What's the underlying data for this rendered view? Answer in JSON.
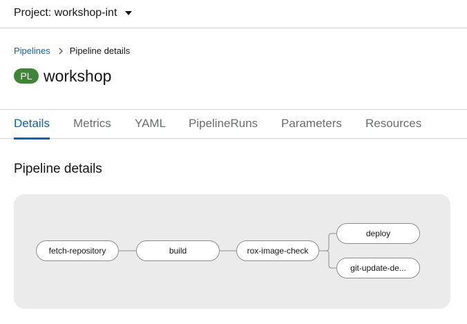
{
  "project": {
    "label": "Project: workshop-int"
  },
  "breadcrumb": {
    "parent": "Pipelines",
    "current": "Pipeline details"
  },
  "header": {
    "badge": "PL",
    "title": "workshop"
  },
  "tabs": [
    {
      "label": "Details",
      "active": true
    },
    {
      "label": "Metrics"
    },
    {
      "label": "YAML"
    },
    {
      "label": "PipelineRuns"
    },
    {
      "label": "Parameters"
    },
    {
      "label": "Resources"
    }
  ],
  "section": {
    "title": "Pipeline details"
  },
  "pipeline": {
    "tasks": [
      "fetch-repository",
      "build",
      "rox-image-check",
      "deploy",
      "git-update-de..."
    ]
  },
  "colors": {
    "accent": "#0066cc",
    "badge": "#3e8635",
    "graph_bg": "#ebebeb"
  }
}
